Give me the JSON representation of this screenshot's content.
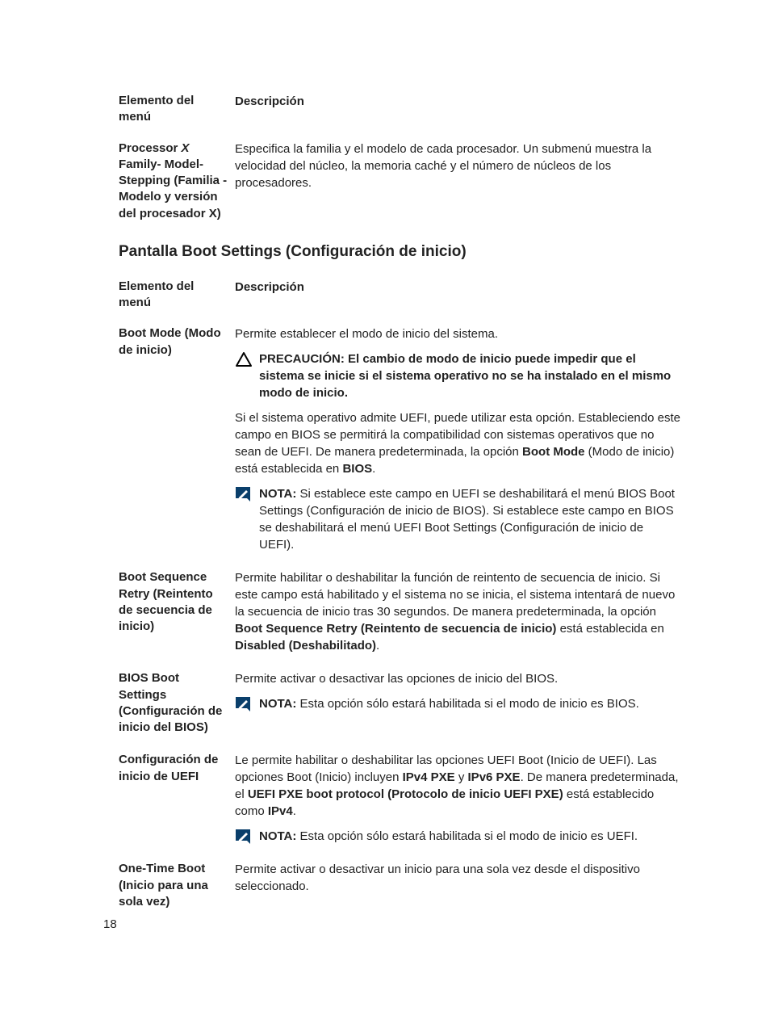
{
  "page_number": "18",
  "table1": {
    "header_col1": "Elemento del menú",
    "header_col2": "Descripción",
    "row1_label_prefix": "Processor ",
    "row1_label_italic": "X",
    "row1_label_after": " Family- Model-Stepping (Familia - Modelo y versión del procesador X)",
    "row1_desc": "Especifica la familia y el modelo de cada procesador. Un submenú muestra la velocidad del núcleo, la memoria caché y el número de núcleos de los procesadores."
  },
  "section_heading": "Pantalla Boot Settings (Configuración de inicio)",
  "table2": {
    "header_col1": "Elemento del menú",
    "header_col2": "Descripción",
    "boot_mode": {
      "label": "Boot Mode (Modo de inicio)",
      "para1": "Permite establecer el modo de inicio del sistema.",
      "caution_prefix": "PRECAUCIÓN: ",
      "caution_text": "El cambio de modo de inicio puede impedir que el sistema se inicie si el sistema operativo no se ha instalado en el mismo modo de inicio.",
      "para2_a": "Si el sistema operativo admite UEFI, puede utilizar esta opción. Estableciendo este campo en BIOS se permitirá la compatibilidad con sistemas operativos que no sean de UEFI. De manera predeterminada, la opción ",
      "para2_b_bold": "Boot Mode",
      "para2_c": " (Modo de inicio) está establecida en ",
      "para2_d_bold": "BIOS",
      "para2_e": ".",
      "note_prefix": "NOTA: ",
      "note_text": "Si establece este campo en UEFI se deshabilitará el menú BIOS Boot Settings (Configuración de inicio de BIOS). Si establece este campo en BIOS se deshabilitará el menú UEFI Boot Settings (Configuración de inicio de UEFI)."
    },
    "boot_seq_retry": {
      "label": "Boot Sequence Retry (Reintento de secuencia de inicio)",
      "desc_a": "Permite habilitar o deshabilitar la función de reintento de secuencia de inicio. Si este campo está habilitado y el sistema no se inicia, el sistema intentará de nuevo la secuencia de inicio tras 30 segundos. De manera predeterminada, la opción ",
      "desc_b_bold": "Boot Sequence Retry (Reintento de secuencia de inicio)",
      "desc_c": " está establecida en ",
      "desc_d_bold": "Disabled (Deshabilitado)",
      "desc_e": "."
    },
    "bios_boot": {
      "label": "BIOS Boot Settings (Configuración de inicio del BIOS)",
      "para": "Permite activar o desactivar las opciones de inicio del BIOS.",
      "note_prefix": "NOTA: ",
      "note_text": "Esta opción sólo estará habilitada si el modo de inicio es BIOS."
    },
    "uefi_boot": {
      "label": "Configuración de inicio de UEFI",
      "para_a": "Le permite habilitar o deshabilitar las opciones UEFI Boot (Inicio de UEFI). Las opciones Boot (Inicio) incluyen ",
      "para_b_bold": "IPv4 PXE",
      "para_c": " y ",
      "para_d_bold": "IPv6 PXE",
      "para_e": ". De manera predeterminada, el ",
      "para_f_bold": "UEFI PXE boot protocol (Protocolo de inicio UEFI PXE)",
      "para_g": " está establecido como ",
      "para_h_bold": "IPv4",
      "para_i": ".",
      "note_prefix": "NOTA: ",
      "note_text": "Esta opción sólo estará habilitada si el modo de inicio es UEFI."
    },
    "one_time": {
      "label": "One-Time Boot (Inicio para una sola vez)",
      "desc": "Permite activar o desactivar un inicio para una sola vez desde el dispositivo seleccionado."
    }
  }
}
